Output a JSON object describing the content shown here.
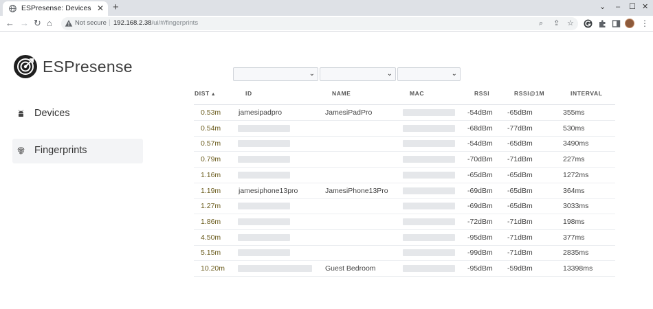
{
  "browser": {
    "tab_title": "ESPresense: Devices",
    "tab_close": "✕",
    "new_tab": "+",
    "window_controls": [
      "⌄",
      "–",
      "☐",
      "✕"
    ],
    "nav": {
      "back": "←",
      "forward": "→",
      "reload": "↻",
      "home": "⌂"
    },
    "security_label": "Not secure",
    "url_separator": "|",
    "url_host": "192.168.2.38",
    "url_path": "/ui/#/fingerprints",
    "omnibox_icons": {
      "zoom": "⌕",
      "share": "⇪",
      "bookmark": "☆"
    },
    "menu": "⋮"
  },
  "sidebar": {
    "brand": "ESPresense",
    "items": [
      {
        "label": "Devices",
        "icon": "android-icon",
        "active": false
      },
      {
        "label": "Fingerprints",
        "icon": "fingerprint-icon",
        "active": true
      }
    ]
  },
  "filters": [
    {
      "value": "",
      "chevron": "⌄"
    },
    {
      "value": "",
      "chevron": "⌄"
    },
    {
      "value": "",
      "chevron": "⌄"
    }
  ],
  "table": {
    "sort_indicator": "▲",
    "columns": [
      "DIST",
      "ID",
      "NAME",
      "MAC",
      "RSSI",
      "RSSI@1M",
      "INTERVAL"
    ],
    "rows": [
      {
        "dist": "0.53m",
        "id": "jamesipadpro",
        "name": "JamesiPadPro",
        "rssi": "-54dBm",
        "rssi1m": "-65dBm",
        "interval": "355ms"
      },
      {
        "dist": "0.54m",
        "id": "",
        "name": "",
        "rssi": "-68dBm",
        "rssi1m": "-77dBm",
        "interval": "530ms"
      },
      {
        "dist": "0.57m",
        "id": "",
        "name": "",
        "rssi": "-54dBm",
        "rssi1m": "-65dBm",
        "interval": "3490ms"
      },
      {
        "dist": "0.79m",
        "id": "",
        "name": "",
        "rssi": "-70dBm",
        "rssi1m": "-71dBm",
        "interval": "227ms"
      },
      {
        "dist": "1.16m",
        "id": "",
        "name": "",
        "rssi": "-65dBm",
        "rssi1m": "-65dBm",
        "interval": "1272ms"
      },
      {
        "dist": "1.19m",
        "id": "jamesiphone13pro",
        "name": "JamesiPhone13Pro",
        "rssi": "-69dBm",
        "rssi1m": "-65dBm",
        "interval": "364ms"
      },
      {
        "dist": "1.27m",
        "id": "",
        "name": "",
        "rssi": "-69dBm",
        "rssi1m": "-65dBm",
        "interval": "3033ms"
      },
      {
        "dist": "1.86m",
        "id": "",
        "name": "",
        "rssi": "-72dBm",
        "rssi1m": "-71dBm",
        "interval": "198ms"
      },
      {
        "dist": "4.50m",
        "id": "",
        "name": "",
        "rssi": "-95dBm",
        "rssi1m": "-71dBm",
        "interval": "377ms"
      },
      {
        "dist": "5.15m",
        "id": "",
        "name": "",
        "rssi": "-99dBm",
        "rssi1m": "-71dBm",
        "interval": "2835ms"
      },
      {
        "dist": "10.20m",
        "id": "",
        "name": "Guest Bedroom",
        "rssi": "-95dBm",
        "rssi1m": "-59dBm",
        "interval": "13398ms"
      }
    ]
  }
}
